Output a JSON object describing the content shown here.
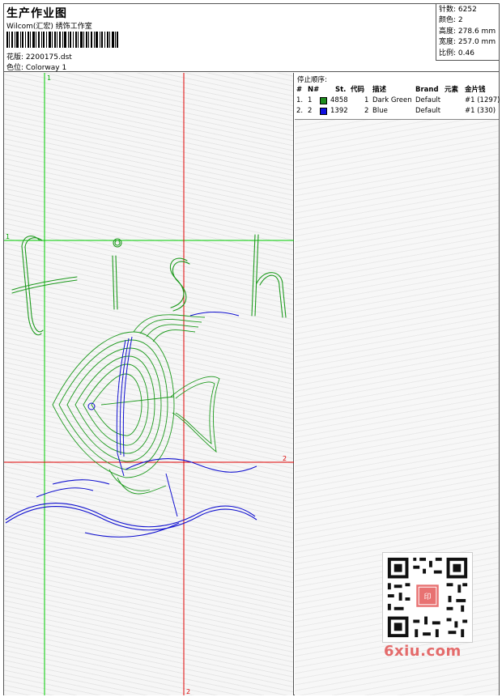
{
  "header": {
    "title": "生产作业图",
    "company": "Wilcom(汇宏) 绣饰工作室",
    "design_label": "花版:",
    "design_value": "2200175.dst",
    "colorway_label": "色位:",
    "colorway_value": "Colorway 1"
  },
  "stats": {
    "stitches_label": "针数:",
    "stitches": "6252",
    "colors_label": "颜色:",
    "colors": "2",
    "height_label": "高度:",
    "height": "278.6 mm",
    "width_label": "宽度:",
    "width": "257.0 mm",
    "ratio_label": "比例:",
    "ratio": "0.46"
  },
  "stop_sequence": {
    "title": "停止顺序:",
    "columns": [
      "#",
      "N#",
      "St.",
      "代码",
      "描述",
      "Brand",
      "元素",
      "金片钱"
    ],
    "rows": [
      {
        "idx": "1.",
        "n": "1",
        "st": "4858",
        "code": "1",
        "desc": "Dark Green",
        "brand": "Default",
        "element": "#1 (1297)",
        "color": "#1e8c1e"
      },
      {
        "idx": "2.",
        "n": "2",
        "st": "1392",
        "code": "2",
        "desc": "Blue",
        "brand": "Default",
        "element": "#1 (330)",
        "color": "#1010e0"
      }
    ]
  },
  "guides": {
    "green_v": "1",
    "green_h": "1",
    "red_h": "2",
    "red_v": "2"
  },
  "watermark": {
    "text": "6xiu.com",
    "seal": "六修图库"
  },
  "colors": {
    "green": "#1e9a1e",
    "blue": "#1010d0",
    "red_line": "#e00000",
    "green_line": "#00cc00"
  }
}
